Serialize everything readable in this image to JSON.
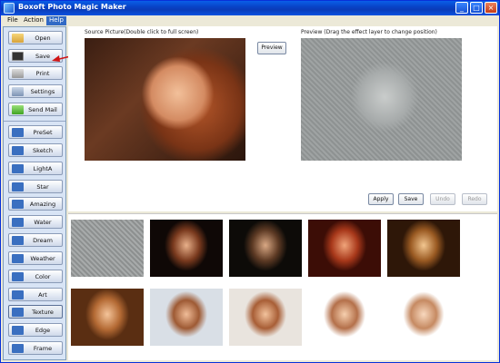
{
  "window": {
    "title": "Boxoft Photo Magic Maker"
  },
  "menu": [
    "File",
    "Action",
    "Help"
  ],
  "colors": {
    "titlebar": "#0a3cb8",
    "sidebar": "#d8e4f5",
    "arrow": "#d01414"
  },
  "sidebar": {
    "top": [
      {
        "label": "Open",
        "icon": "folder-icon"
      },
      {
        "label": "Save",
        "icon": "save-icon"
      },
      {
        "label": "Print",
        "icon": "printer-icon"
      },
      {
        "label": "Settings",
        "icon": "settings-icon"
      },
      {
        "label": "Send Mail",
        "icon": "send-mail-icon"
      }
    ],
    "effects": [
      {
        "label": "PreSet",
        "icon": "preset-icon"
      },
      {
        "label": "Sketch",
        "icon": "sketch-icon"
      },
      {
        "label": "LightA",
        "icon": "light-icon"
      },
      {
        "label": "Star",
        "icon": "star-icon"
      },
      {
        "label": "Amazing",
        "icon": "amazing-icon"
      },
      {
        "label": "Water",
        "icon": "water-icon"
      },
      {
        "label": "Dream",
        "icon": "dream-icon"
      },
      {
        "label": "Weather",
        "icon": "weather-icon"
      },
      {
        "label": "Color",
        "icon": "color-icon"
      },
      {
        "label": "Art",
        "icon": "art-icon"
      },
      {
        "label": "Texture",
        "icon": "texture-icon"
      },
      {
        "label": "Edge",
        "icon": "edge-icon"
      },
      {
        "label": "Frame",
        "icon": "frame-icon"
      }
    ],
    "selected": "Texture"
  },
  "source": {
    "caption": "Source Picture(Double click to full screen)"
  },
  "preview": {
    "caption": "Preview (Drag the effect layer to change position)",
    "button": "Preview"
  },
  "actions": {
    "apply": "Apply",
    "save": "Save",
    "undo": "Undo",
    "redo": "Redo"
  },
  "thumbnails": [
    "emboss",
    "dark-contrast",
    "cool-dark",
    "warm-red",
    "sepia",
    "warm-golden",
    "soft-vignette",
    "warm-soft",
    "bright-vignette",
    "light-fade"
  ]
}
